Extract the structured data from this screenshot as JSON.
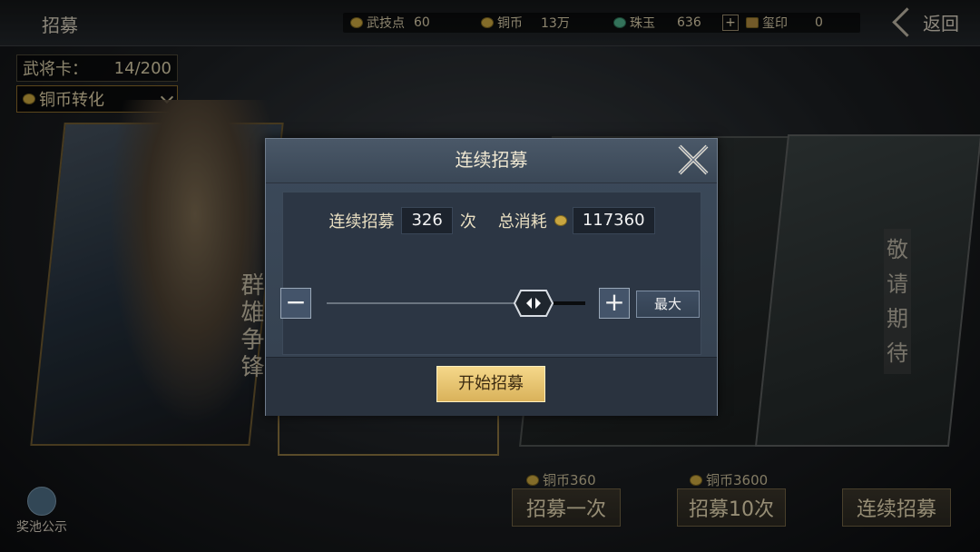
{
  "topbar": {
    "title": "招募",
    "resources": [
      {
        "icon": "skill-point-icon",
        "label": "武技点",
        "value": "60"
      },
      {
        "icon": "copper-coin-icon",
        "label": "铜币",
        "value": "13万"
      },
      {
        "icon": "jade-icon",
        "label": "珠玉",
        "value": "636"
      },
      {
        "icon": "seal-icon",
        "label": "玺印",
        "value": "0"
      }
    ],
    "plus": "+",
    "back_label": "返回"
  },
  "left_panel": {
    "card_label": "武将卡：",
    "card_count": "14/200",
    "convert_label": "铜币转化"
  },
  "hero": {
    "slogan": "群雄争锋"
  },
  "coming_soon": "敬请期待",
  "bottom": {
    "pool_label": "奖池公示",
    "buttons": [
      {
        "cost": "铜币360",
        "label": "招募一次"
      },
      {
        "cost": "铜币3600",
        "label": "招募10次"
      },
      {
        "cost": "",
        "label": "连续招募"
      }
    ]
  },
  "dialog": {
    "title": "连续招募",
    "count_label": "连续招募",
    "count_value": "326",
    "count_unit": "次",
    "total_label": "总消耗",
    "total_value": "117360",
    "minus": "−",
    "plus": "+",
    "max_label": "最大",
    "start_label": "开始招募",
    "slider_fraction": 0.8
  }
}
